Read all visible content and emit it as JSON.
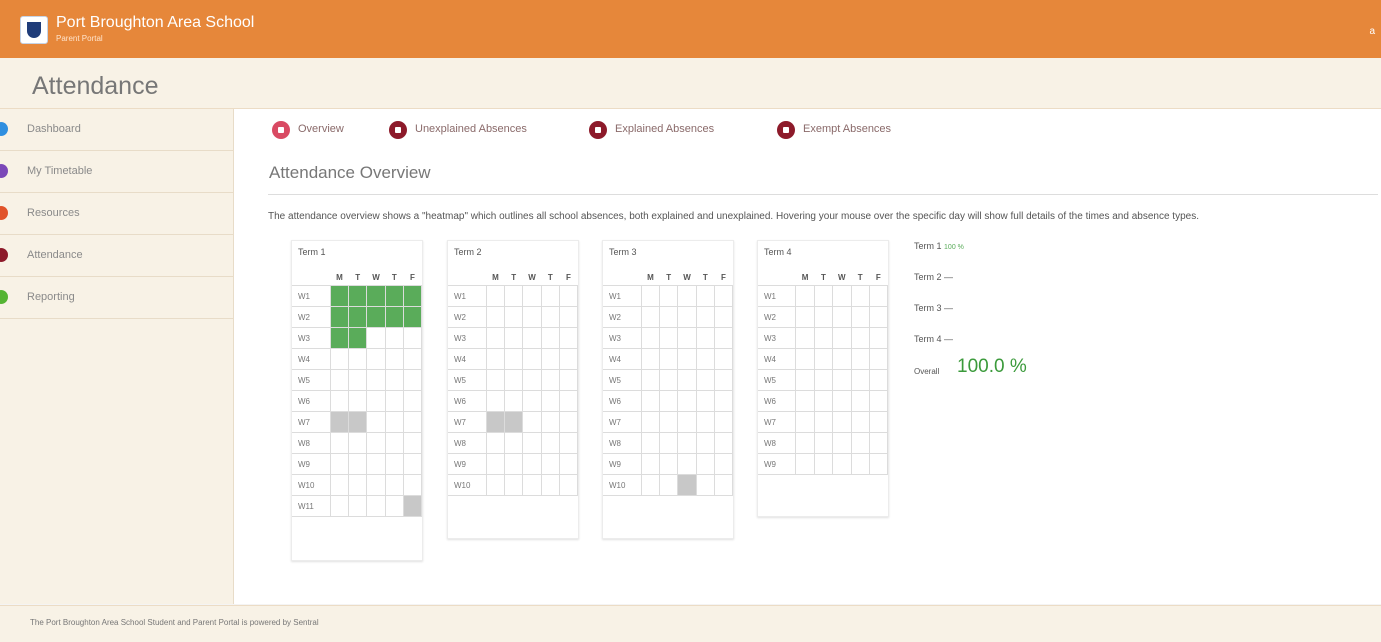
{
  "header": {
    "school_name": "Port Broughton Area School",
    "portal_name": "Parent Portal",
    "user": "a"
  },
  "page": {
    "title": "Attendance"
  },
  "sidebar": {
    "items": [
      {
        "label": "Dashboard",
        "color": "#2f8fe0"
      },
      {
        "label": "My Timetable",
        "color": "#7b48b8"
      },
      {
        "label": "Resources",
        "color": "#e1532a"
      },
      {
        "label": "Attendance",
        "color": "#8d1a2a"
      },
      {
        "label": "Reporting",
        "color": "#55b433"
      }
    ]
  },
  "tabs": [
    {
      "label": "Overview",
      "color": "#d94a63"
    },
    {
      "label": "Unexplained Absences",
      "color": "#8d1a2a"
    },
    {
      "label": "Explained Absences",
      "color": "#8d1a2a"
    },
    {
      "label": "Exempt Absences",
      "color": "#8d1a2a"
    }
  ],
  "overview": {
    "title": "Attendance Overview",
    "description": "The attendance overview shows a \"heatmap\" which outlines all school absences, both explained and unexplained. Hovering your mouse over the specific day will show full details of the times and absence types."
  },
  "days": [
    "M",
    "T",
    "W",
    "T",
    "F"
  ],
  "terms": [
    {
      "name": "Term 1",
      "weeks": [
        "W1",
        "W2",
        "W3",
        "W4",
        "W5",
        "W6",
        "W7",
        "W8",
        "W9",
        "W10",
        "W11"
      ],
      "cells": [
        [
          "p",
          "p",
          "p",
          "p",
          "p"
        ],
        [
          "p",
          "p",
          "p",
          "p",
          "p"
        ],
        [
          "p",
          "p",
          "",
          "",
          ""
        ],
        [
          "",
          "",
          "",
          "",
          ""
        ],
        [
          "",
          "",
          "",
          "",
          ""
        ],
        [
          "",
          "",
          "",
          "",
          ""
        ],
        [
          "a",
          "a",
          "",
          "",
          ""
        ],
        [
          "",
          "",
          "",
          "",
          ""
        ],
        [
          "",
          "",
          "",
          "",
          ""
        ],
        [
          "",
          "",
          "",
          "",
          ""
        ],
        [
          "",
          "",
          "",
          "",
          "a"
        ]
      ]
    },
    {
      "name": "Term 2",
      "weeks": [
        "W1",
        "W2",
        "W3",
        "W4",
        "W5",
        "W6",
        "W7",
        "W8",
        "W9",
        "W10"
      ],
      "cells": [
        [
          "",
          "",
          "",
          "",
          ""
        ],
        [
          "",
          "",
          "",
          "",
          ""
        ],
        [
          "",
          "",
          "",
          "",
          ""
        ],
        [
          "",
          "",
          "",
          "",
          ""
        ],
        [
          "",
          "",
          "",
          "",
          ""
        ],
        [
          "",
          "",
          "",
          "",
          ""
        ],
        [
          "a",
          "a",
          "",
          "",
          ""
        ],
        [
          "",
          "",
          "",
          "",
          ""
        ],
        [
          "",
          "",
          "",
          "",
          ""
        ],
        [
          "",
          "",
          "",
          "",
          ""
        ]
      ]
    },
    {
      "name": "Term 3",
      "weeks": [
        "W1",
        "W2",
        "W3",
        "W4",
        "W5",
        "W6",
        "W7",
        "W8",
        "W9",
        "W10"
      ],
      "cells": [
        [
          "",
          "",
          "",
          "",
          ""
        ],
        [
          "",
          "",
          "",
          "",
          ""
        ],
        [
          "",
          "",
          "",
          "",
          ""
        ],
        [
          "",
          "",
          "",
          "",
          ""
        ],
        [
          "",
          "",
          "",
          "",
          ""
        ],
        [
          "",
          "",
          "",
          "",
          ""
        ],
        [
          "",
          "",
          "",
          "",
          ""
        ],
        [
          "",
          "",
          "",
          "",
          ""
        ],
        [
          "",
          "",
          "",
          "",
          ""
        ],
        [
          "",
          "",
          "a",
          "",
          ""
        ]
      ]
    },
    {
      "name": "Term 4",
      "weeks": [
        "W1",
        "W2",
        "W3",
        "W4",
        "W5",
        "W6",
        "W7",
        "W8",
        "W9"
      ],
      "cells": [
        [
          "",
          "",
          "",
          "",
          ""
        ],
        [
          "",
          "",
          "",
          "",
          ""
        ],
        [
          "",
          "",
          "",
          "",
          ""
        ],
        [
          "",
          "",
          "",
          "",
          ""
        ],
        [
          "",
          "",
          "",
          "",
          ""
        ],
        [
          "",
          "",
          "",
          "",
          ""
        ],
        [
          "",
          "",
          "",
          "",
          ""
        ],
        [
          "",
          "",
          "",
          "",
          ""
        ],
        [
          "",
          "",
          "",
          "",
          ""
        ]
      ]
    }
  ],
  "summary": {
    "term1_label": "Term 1",
    "term1_value": "100 %",
    "term2_label": "Term 2",
    "term2_value": "—",
    "term3_label": "Term 3",
    "term3_value": "—",
    "term4_label": "Term 4",
    "term4_value": "—",
    "overall_label": "Overall",
    "overall_value": "100.0 %"
  },
  "colors": {
    "header": "#e6873a",
    "present": "#5aac5a",
    "absent": "#c8c8c8",
    "overall": "#3b9a3b"
  },
  "footer": {
    "text": "The Port Broughton Area School Student and Parent Portal is powered by Sentral"
  }
}
